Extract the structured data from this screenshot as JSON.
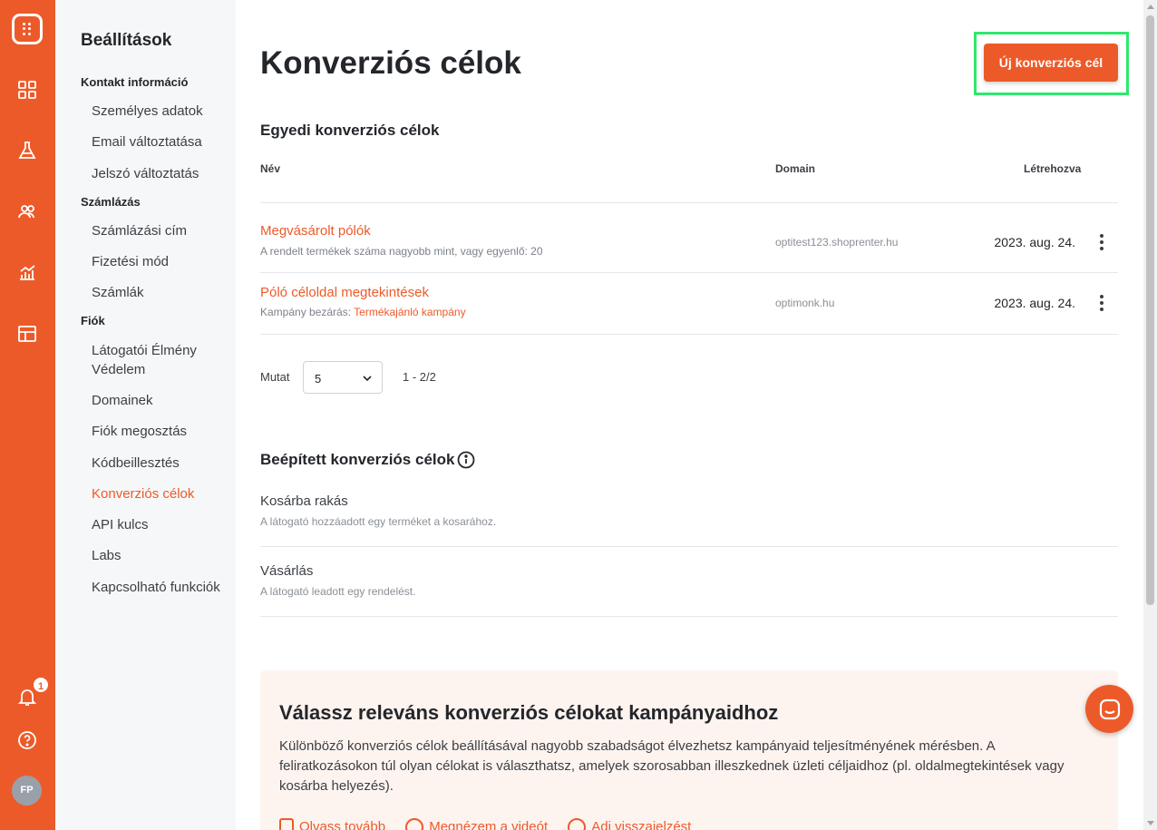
{
  "rail": {
    "badge_count": "1",
    "avatar_initials": "FP",
    "icons": [
      "app-logo-icon",
      "dashboard-icon",
      "flask-icon",
      "users-icon",
      "analytics-icon",
      "templates-icon",
      "bell-icon",
      "help-icon"
    ],
    "accent_color": "#ed5a29"
  },
  "sidebar": {
    "title": "Beállítások",
    "groups": [
      {
        "label": "Kontakt információ",
        "items": [
          "Személyes adatok",
          "Email változtatása",
          "Jelszó változtatás"
        ]
      },
      {
        "label": "Számlázás",
        "items": [
          "Számlázási cím",
          "Fizetési mód",
          "Számlák"
        ]
      },
      {
        "label": "Fiók",
        "items": [
          "Látogatói Élmény Védelem",
          "Domainek",
          "Fiók megosztás",
          "Kódbeillesztés",
          "Konverziós célok",
          "API kulcs",
          "Labs",
          "Kapcsolható funkciók"
        ]
      }
    ],
    "active_item": "Konverziós célok"
  },
  "main": {
    "title": "Konverziós célok",
    "new_button": "Új konverziós cél",
    "custom": {
      "title": "Egyedi konverziós célok",
      "columns": {
        "name": "Név",
        "domain": "Domain",
        "created": "Létrehozva"
      },
      "rows": [
        {
          "name": "Megvásárolt pólók",
          "sub": "A rendelt termékek száma nagyobb mint, vagy egyenlő: 20",
          "sub_link": "",
          "domain": "optitest123.shoprenter.hu",
          "created": "2023. aug. 24."
        },
        {
          "name": "Póló céloldal megtekintések",
          "sub": "Kampány bezárás: ",
          "sub_link": "Termékajánló kampány",
          "domain": "optimonk.hu",
          "created": "2023. aug. 24."
        }
      ],
      "show_label": "Mutat",
      "page_size": "5",
      "pagination": "1 - 2/2"
    },
    "builtin": {
      "title": "Beépített konverziós célok",
      "items": [
        {
          "title": "Kosárba rakás",
          "sub": "A látogató hozzáadott egy terméket a kosarához."
        },
        {
          "title": "Vásárlás",
          "sub": "A látogató leadott egy rendelést."
        }
      ]
    },
    "banner": {
      "title": "Válassz releváns konverziós célokat kampányaidhoz",
      "text": "Különböző konverziós célok beállításával nagyobb szabadságot élvezhetsz kampányaid teljesítményének mérésben. A feliratkozásokon túl olyan célokat is választhatsz, amelyek szorosabban illeszkednek üzleti céljaidhoz (pl. oldalmegtekintések vagy kosárba helyezés).",
      "links": [
        "Olvass tovább",
        "Megnézem a videót",
        "Adj visszajelzést"
      ]
    }
  }
}
